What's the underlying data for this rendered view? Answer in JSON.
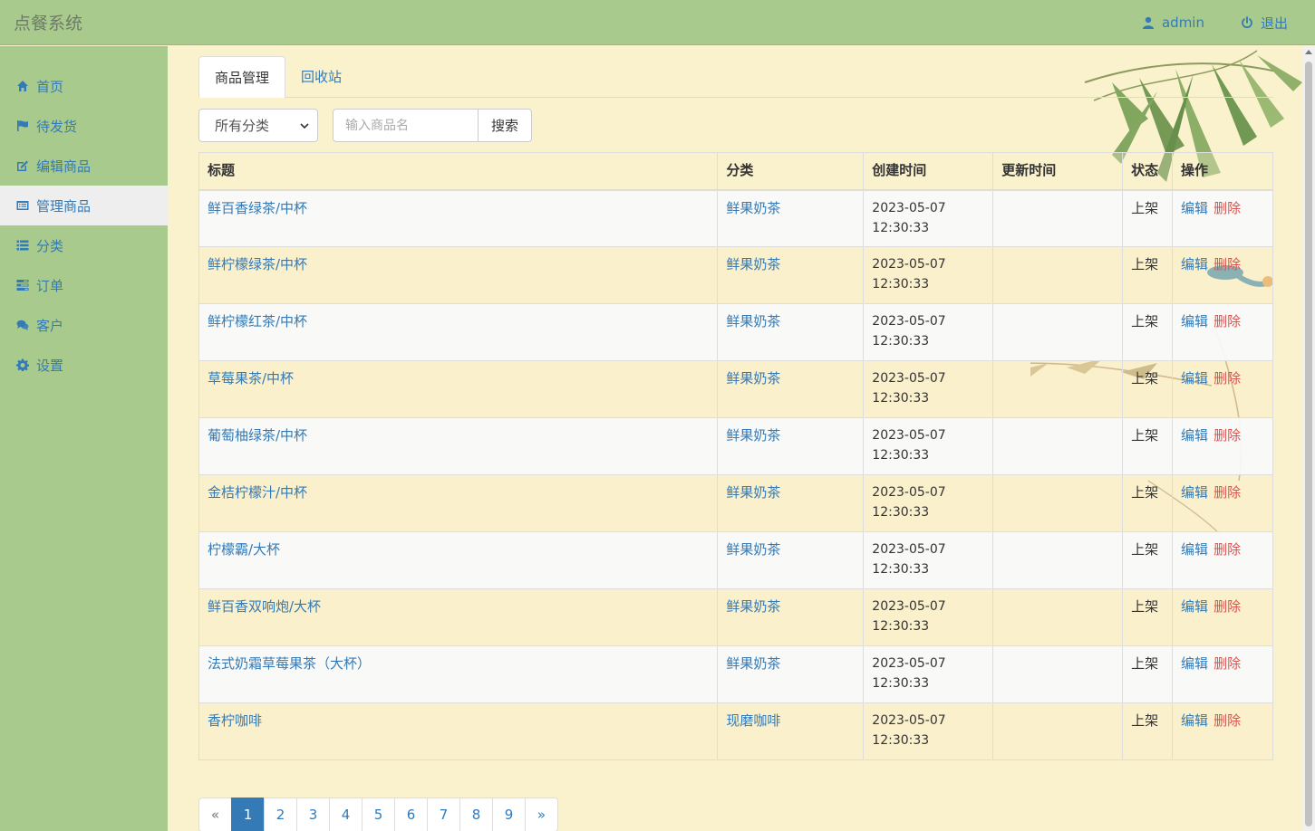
{
  "app": {
    "title": "点餐系统"
  },
  "header": {
    "user_label": "admin",
    "logout_label": "退出"
  },
  "sidebar": {
    "items": [
      {
        "label": "首页",
        "icon": "home-icon"
      },
      {
        "label": "待发货",
        "icon": "flag-icon"
      },
      {
        "label": "编辑商品",
        "icon": "edit-icon"
      },
      {
        "label": "管理商品",
        "icon": "list-alt-icon",
        "active": true
      },
      {
        "label": "分类",
        "icon": "list-icon"
      },
      {
        "label": "订单",
        "icon": "tasks-icon"
      },
      {
        "label": "客户",
        "icon": "comments-icon"
      },
      {
        "label": "设置",
        "icon": "gear-icon"
      }
    ]
  },
  "tabs": [
    {
      "label": "商品管理",
      "active": true
    },
    {
      "label": "回收站"
    }
  ],
  "filter": {
    "category_selected": "所有分类",
    "search_placeholder": "输入商品名",
    "search_button": "搜索"
  },
  "table": {
    "headers": [
      "标题",
      "分类",
      "创建时间",
      "更新时间",
      "状态",
      "操作"
    ],
    "edit_label": "编辑",
    "delete_label": "删除",
    "rows": [
      {
        "title": "鲜百香绿茶/中杯",
        "category": "鲜果奶茶",
        "created_date": "2023-05-07",
        "created_time": "12:30:33",
        "updated": "",
        "status": "上架"
      },
      {
        "title": "鲜柠檬绿茶/中杯",
        "category": "鲜果奶茶",
        "created_date": "2023-05-07",
        "created_time": "12:30:33",
        "updated": "",
        "status": "上架"
      },
      {
        "title": "鲜柠檬红茶/中杯",
        "category": "鲜果奶茶",
        "created_date": "2023-05-07",
        "created_time": "12:30:33",
        "updated": "",
        "status": "上架"
      },
      {
        "title": "草莓果茶/中杯",
        "category": "鲜果奶茶",
        "created_date": "2023-05-07",
        "created_time": "12:30:33",
        "updated": "",
        "status": "上架"
      },
      {
        "title": "葡萄柚绿茶/中杯",
        "category": "鲜果奶茶",
        "created_date": "2023-05-07",
        "created_time": "12:30:33",
        "updated": "",
        "status": "上架"
      },
      {
        "title": "金桔柠檬汁/中杯",
        "category": "鲜果奶茶",
        "created_date": "2023-05-07",
        "created_time": "12:30:33",
        "updated": "",
        "status": "上架"
      },
      {
        "title": "柠檬霸/大杯",
        "category": "鲜果奶茶",
        "created_date": "2023-05-07",
        "created_time": "12:30:33",
        "updated": "",
        "status": "上架"
      },
      {
        "title": "鲜百香双响炮/大杯",
        "category": "鲜果奶茶",
        "created_date": "2023-05-07",
        "created_time": "12:30:33",
        "updated": "",
        "status": "上架"
      },
      {
        "title": "法式奶霜草莓果茶（大杯）",
        "category": "鲜果奶茶",
        "created_date": "2023-05-07",
        "created_time": "12:30:33",
        "updated": "",
        "status": "上架"
      },
      {
        "title": "香柠咖啡",
        "category": "现磨咖啡",
        "created_date": "2023-05-07",
        "created_time": "12:30:33",
        "updated": "",
        "status": "上架"
      }
    ]
  },
  "pagination": {
    "prev": "«",
    "next": "»",
    "pages": [
      "1",
      "2",
      "3",
      "4",
      "5",
      "6",
      "7",
      "8",
      "9"
    ],
    "current": "1"
  },
  "colors": {
    "bar_green": "#a8cb8d",
    "page_bg": "#faf1cd",
    "link_blue": "#337ab7",
    "delete_red": "#d9534f"
  }
}
